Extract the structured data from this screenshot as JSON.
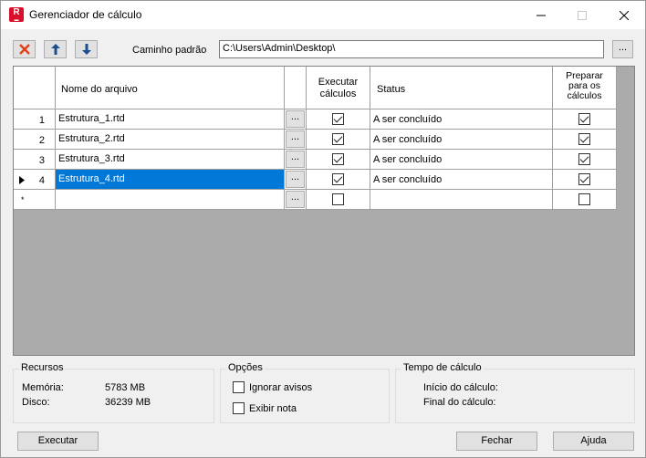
{
  "window": {
    "title": "Gerenciador de cálculo",
    "app_icon_text": "R"
  },
  "toolbar": {
    "path_label": "Caminho padrão",
    "path_value": "C:\\Users\\Admin\\Desktop\\",
    "browse_label": "..."
  },
  "grid": {
    "headers": {
      "file": "Nome do arquivo",
      "execute": "Executar cálculos",
      "status": "Status",
      "prepare": "Preparar para os cálculos"
    },
    "rows": [
      {
        "num": "1",
        "file": "Estrutura_1.rtd",
        "browse": "...",
        "status": "A ser concluído",
        "execute": true,
        "prepare": true
      },
      {
        "num": "2",
        "file": "Estrutura_2.rtd",
        "browse": "...",
        "status": "A ser concluído",
        "execute": true,
        "prepare": true
      },
      {
        "num": "3",
        "file": "Estrutura_3.rtd",
        "browse": "...",
        "status": "A ser concluído",
        "execute": true,
        "prepare": true
      },
      {
        "num": "4",
        "file": "Estrutura_4.rtd",
        "browse": "...",
        "status": "A ser concluído",
        "execute": true,
        "prepare": true
      }
    ],
    "new_row": {
      "marker": "*",
      "browse": "...",
      "execute": false,
      "prepare": false
    }
  },
  "resources": {
    "title": "Recursos",
    "memory_label": "Memória:",
    "memory_value": "5783 MB",
    "disk_label": "Disco:",
    "disk_value": "36239 MB"
  },
  "options": {
    "title": "Opções",
    "ignore_warnings": "Ignorar avisos",
    "show_note": "Exibir nota"
  },
  "calc_time": {
    "title": "Tempo de cálculo",
    "start_label": "Início do cálculo:",
    "end_label": "Final do cálculo:"
  },
  "buttons": {
    "execute": "Executar",
    "close": "Fechar",
    "help": "Ajuda"
  },
  "colors": {
    "selection": "#0078d7",
    "delete_red": "#e0401a",
    "arrow_blue": "#1d4e8f"
  }
}
